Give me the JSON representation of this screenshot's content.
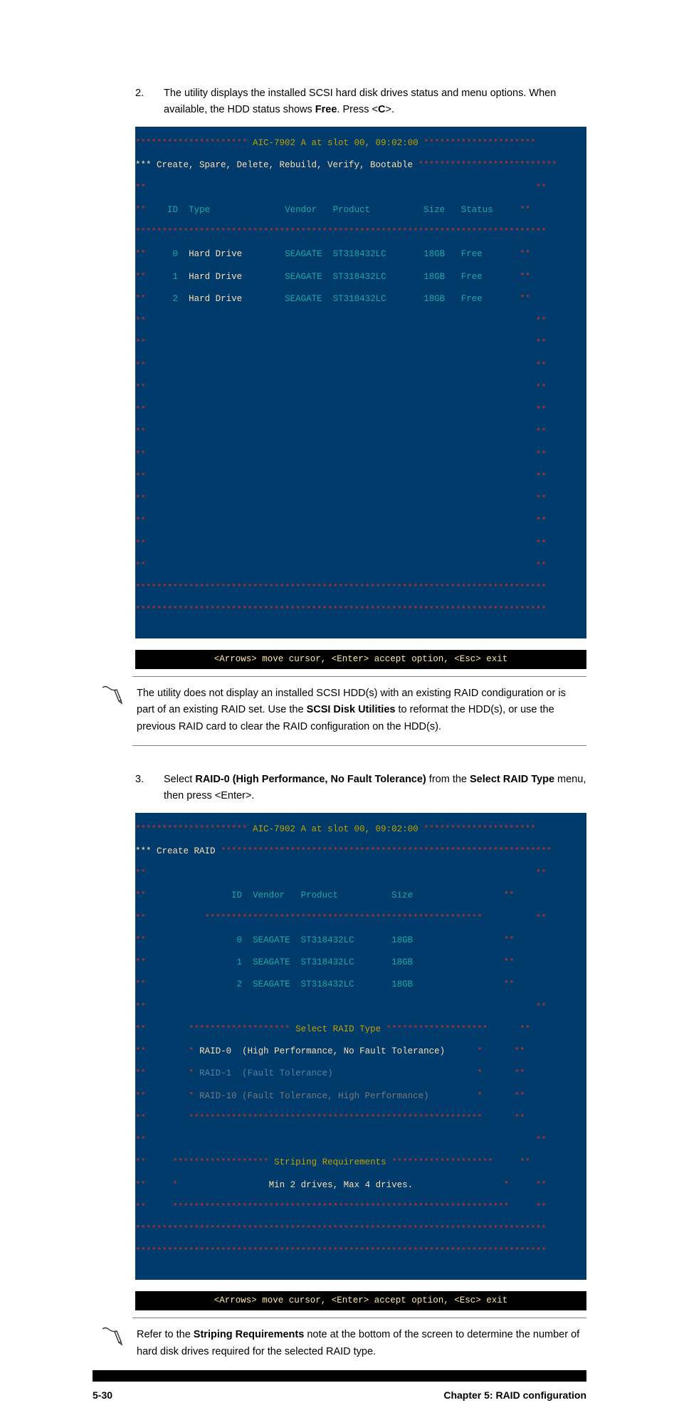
{
  "steps": {
    "s2": {
      "num": "2.",
      "text_a": "The utility displays the installed SCSI hard disk drives status and menu options. When available, the HDD status shows ",
      "text_b": "Free",
      "text_c": ". Press <",
      "text_d": "C",
      "text_e": ">."
    },
    "s3": {
      "num": "3.",
      "text_a": "Select ",
      "text_b": "RAID-0 (High Performance, No Fault Tolerance)",
      "text_c": " from the ",
      "text_d": "Select RAID Type",
      "text_e": " menu, then press <Enter>."
    }
  },
  "notes": {
    "n1": {
      "a": "The utility does not display an installed SCSI HDD(s) with an existing RAID condiguration or is part of an existing RAID set. Use the ",
      "b": "SCSI Disk Utilities",
      "c": " to reformat the HDD(s), or use the previous RAID card to clear the RAID configuration on the HDD(s)."
    },
    "n2": {
      "a": "Refer to the ",
      "b": "Striping Requirements",
      "c": " note at the bottom of the screen to determine the number of hard disk drives required for the selected RAID type."
    }
  },
  "term1": {
    "title_l": "********************* ",
    "title_m": "AIC-7902 A at slot 00, 09:02:00",
    "title_r": " *********************",
    "menu": "*** Create, Spare, Delete, Rebuild, Verify, Bootable",
    "menu_stars": " **************************",
    "border_stars": "**",
    "hdr": {
      "id": "ID",
      "type": "Type",
      "vendor": "Vendor",
      "product": "Product",
      "size": "Size",
      "status": "Status"
    },
    "hdr_sep": "*************************************************************************",
    "rows": [
      {
        "id": "0",
        "type": "Hard Drive",
        "vendor": "SEAGATE",
        "product": "ST318432LC",
        "size": "18GB",
        "status": "Free"
      },
      {
        "id": "1",
        "type": "Hard Drive",
        "vendor": "SEAGATE",
        "product": "ST318432LC",
        "size": "18GB",
        "status": "Free"
      },
      {
        "id": "2",
        "type": "Hard Drive",
        "vendor": "SEAGATE",
        "product": "ST318432LC",
        "size": "18GB",
        "status": "Free"
      }
    ],
    "bottom_stars": "*****************************************************************************",
    "foot": "<Arrows> move cursor, <Enter> accept option, <Esc> exit"
  },
  "term2": {
    "title_l": "********************* ",
    "title_m": "AIC-7902 A at slot 00, 09:02:00",
    "title_r": " *********************",
    "menu": "*** Create RAID",
    "menu_stars": " **************************************************************",
    "border_stars": "**",
    "hdr": {
      "id": "ID",
      "vendor": "Vendor",
      "product": "Product",
      "size": "Size"
    },
    "hdr_sep": "****************************************************",
    "rows": [
      {
        "id": "0",
        "vendor": "SEAGATE",
        "product": "ST318432LC",
        "size": "18GB"
      },
      {
        "id": "1",
        "vendor": "SEAGATE",
        "product": "ST318432LC",
        "size": "18GB"
      },
      {
        "id": "2",
        "vendor": "SEAGATE",
        "product": "ST318432LC",
        "size": "18GB"
      }
    ],
    "popup": {
      "title_l": "******************* ",
      "title_m": "Select RAID Type",
      "title_r": " *******************",
      "opt_a": "RAID-0  (High Performance, No Fault Tolerance)",
      "marker_a": "*",
      "opt_b": "RAID-1  (Fault Tolerance)",
      "marker_b": "*",
      "opt_c": "RAID-10 (Fault Tolerance, High Performance)",
      "marker_c": "*",
      "foot_row": "*******************************************************"
    },
    "req": {
      "title_l": "****************** ",
      "title_m": "Striping Requirements",
      "title_r": " *******************",
      "line": "Min 2 drives, Max 4 drives.",
      "marker": "*",
      "foot_row": "***************************************************************"
    },
    "bottom_stars": "*****************************************************************************",
    "foot": "<Arrows> move cursor, <Enter> accept option, <Esc> exit"
  },
  "footer": {
    "left": "5-30",
    "right": "Chapter 5: RAID configuration"
  }
}
